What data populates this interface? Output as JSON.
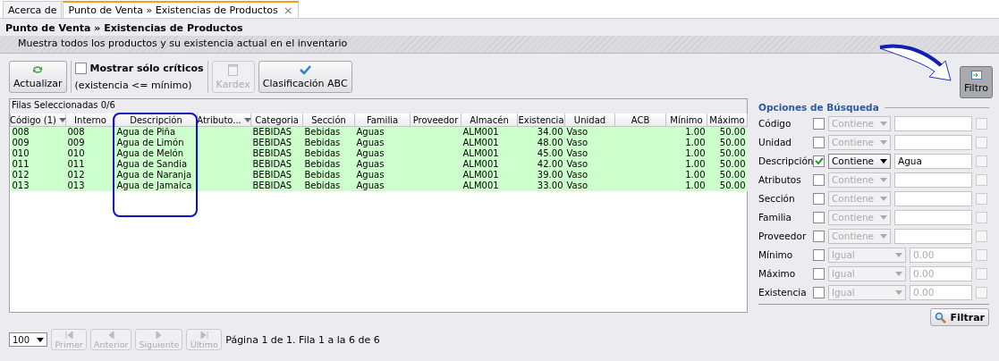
{
  "tabs": [
    {
      "label": "Acerca de",
      "selected": false,
      "closable": false
    },
    {
      "label": "Punto de Venta » Existencias de Productos",
      "selected": true,
      "closable": true
    }
  ],
  "tab_close": "×",
  "header": {
    "title": "Punto de Venta » Existencias de Productos",
    "subtitle": "Muestra todos los productos y su existencia actual en el inventario"
  },
  "toolbar": {
    "refresh": {
      "label": "Actualizar",
      "disabled": false
    },
    "critical": {
      "label": "Mostrar sólo críticos",
      "hint": "(existencia <= mínimo)",
      "checked": false
    },
    "kardex": {
      "label": "Kardex",
      "disabled": true
    },
    "abc": {
      "label": "Clasificación ABC",
      "disabled": false
    },
    "filter": {
      "label": "Filtro",
      "on": true
    }
  },
  "grid": {
    "selection": "Filas Seleccionadas  0/6",
    "columns": [
      {
        "label": "Código (1)",
        "kind": "text",
        "dropdown": true
      },
      {
        "label": "Interno",
        "kind": "text",
        "dropdown": false
      },
      {
        "label": "Descripción",
        "kind": "text",
        "dropdown": false
      },
      {
        "label": "Atributo...",
        "kind": "text",
        "dropdown": true
      },
      {
        "label": "Categoria",
        "kind": "text",
        "dropdown": false
      },
      {
        "label": "Sección",
        "kind": "text",
        "dropdown": false
      },
      {
        "label": "Familia",
        "kind": "text",
        "dropdown": false
      },
      {
        "label": "Proveedor",
        "kind": "text",
        "dropdown": false
      },
      {
        "label": "Almacén",
        "kind": "text",
        "dropdown": false
      },
      {
        "label": "Existencia",
        "kind": "number",
        "dropdown": false
      },
      {
        "label": "Unidad",
        "kind": "text",
        "dropdown": false
      },
      {
        "label": "ACB",
        "kind": "text",
        "dropdown": false
      },
      {
        "label": "Mínimo",
        "kind": "number",
        "dropdown": false
      },
      {
        "label": "Máximo",
        "kind": "number",
        "dropdown": false
      }
    ],
    "rows": [
      [
        "008",
        "008",
        "Agua de Piña",
        "",
        "BEBIDAS",
        "Bebidas",
        "Aguas",
        "",
        "ALM001",
        "34.00",
        "Vaso",
        "",
        "1.00",
        "50.00"
      ],
      [
        "009",
        "009",
        "Agua de Limón",
        "",
        "BEBIDAS",
        "Bebidas",
        "Aguas",
        "",
        "ALM001",
        "48.00",
        "Vaso",
        "",
        "1.00",
        "50.00"
      ],
      [
        "010",
        "010",
        "Agua de Melón",
        "",
        "BEBIDAS",
        "Bebidas",
        "Aguas",
        "",
        "ALM001",
        "45.00",
        "Vaso",
        "",
        "1.00",
        "50.00"
      ],
      [
        "011",
        "011",
        "Agua de Sandia",
        "",
        "BEBIDAS",
        "Bebidas",
        "Aguas",
        "",
        "ALM001",
        "42.00",
        "Vaso",
        "",
        "1.00",
        "50.00"
      ],
      [
        "012",
        "012",
        "Agua de Naranja",
        "",
        "BEBIDAS",
        "Bebidas",
        "Aguas",
        "",
        "ALM001",
        "39.00",
        "Vaso",
        "",
        "1.00",
        "50.00"
      ],
      [
        "013",
        "013",
        "Agua de Jamaica",
        "",
        "BEBIDAS",
        "Bebidas",
        "Aguas",
        "",
        "ALM001",
        "33.00",
        "Vaso",
        "",
        "1.00",
        "50.00"
      ]
    ]
  },
  "search": {
    "title": "Opciones de Búsqueda",
    "button": "Filtrar",
    "fields": [
      {
        "label": "Código",
        "kind": "text",
        "checked": false,
        "operator": "Contiene",
        "extra_checked": false
      },
      {
        "label": "Unidad",
        "kind": "text",
        "checked": false,
        "operator": "Contiene",
        "extra_checked": false
      },
      {
        "label": "Descripción",
        "kind": "text",
        "checked": true,
        "operator": "Contiene",
        "value": "Agua",
        "extra_checked": false
      },
      {
        "label": "Atributos",
        "kind": "text",
        "checked": false,
        "operator": "Contiene",
        "extra_checked": false
      },
      {
        "label": "Sección",
        "kind": "text",
        "checked": false,
        "operator": "Contiene",
        "extra_checked": false
      },
      {
        "label": "Familia",
        "kind": "text",
        "checked": false,
        "operator": "Contiene",
        "extra_checked": false
      },
      {
        "label": "Proveedor",
        "kind": "text",
        "checked": false,
        "operator": "Contiene",
        "extra_checked": false
      },
      {
        "label": "Mínimo",
        "kind": "number",
        "checked": false,
        "operator": "Igual",
        "value": "0.00",
        "extra_checked": false
      },
      {
        "label": "Máximo",
        "kind": "number",
        "checked": false,
        "operator": "Igual",
        "value": "0.00",
        "extra_checked": false
      },
      {
        "label": "Existencia",
        "kind": "number",
        "checked": false,
        "operator": "Igual",
        "value": "0.00",
        "extra_checked": false
      }
    ]
  },
  "pager": {
    "page_size": "100",
    "buttons": [
      {
        "label": "Primer",
        "disabled": true
      },
      {
        "label": "Anterior",
        "disabled": true
      },
      {
        "label": "Siguiente",
        "disabled": true
      },
      {
        "label": "Último",
        "disabled": true
      }
    ],
    "status": "Página 1 de 1. Fila 1 a la 6 de 6"
  }
}
